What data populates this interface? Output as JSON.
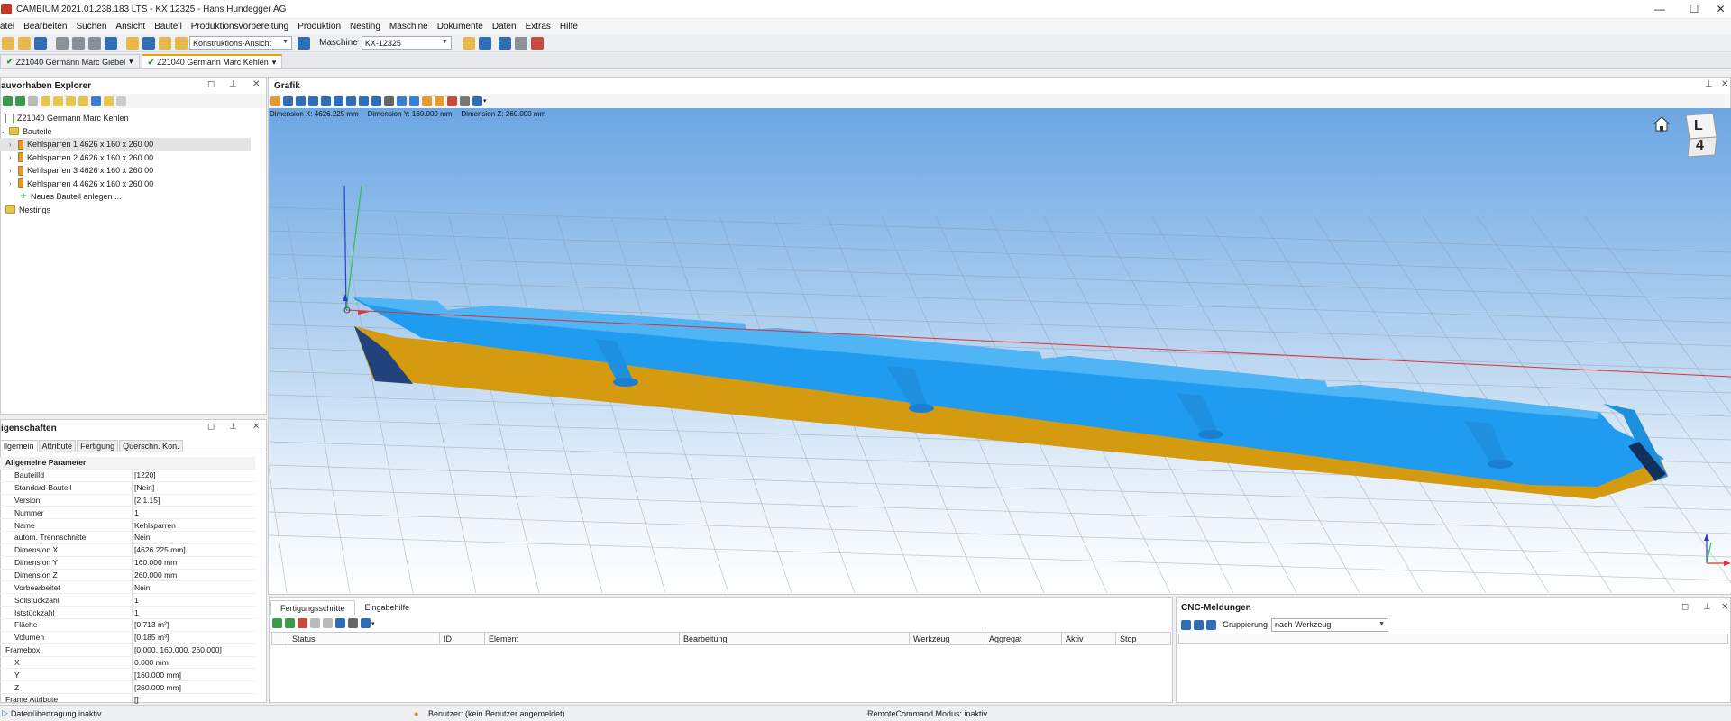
{
  "window": {
    "title": "CAMBIUM 2021.01.238.183 LTS - KX 12325 - Hans Hundegger AG",
    "min_icon": "minimize-icon",
    "max_icon": "maximize-icon",
    "close_icon": "close-icon"
  },
  "menu": [
    "atei",
    "Bearbeiten",
    "Suchen",
    "Ansicht",
    "Bauteil",
    "Produktionsvorbereitung",
    "Produktion",
    "Nesting",
    "Maschine",
    "Dokumente",
    "Daten",
    "Extras",
    "Hilfe"
  ],
  "toolbar": {
    "view_combo": "Konstruktions-Ansicht",
    "machine_label": "Maschine",
    "machine_combo": "KX-12325"
  },
  "doc_tabs": [
    "Z21040 Germann Marc Giebel",
    "Z21040 Germann Marc Kehlen"
  ],
  "explorer": {
    "title": "auvorhaben Explorer",
    "tree": [
      {
        "label": "Z21040 Germann Marc Kehlen",
        "icon": "doc"
      },
      {
        "label": "Bauteile",
        "icon": "folder"
      },
      {
        "label": "Kehlsparren 1 4626 x 160 x 260 00",
        "icon": "beam"
      },
      {
        "label": "Kehlsparren 2 4626 x 160 x 260 00",
        "icon": "beam"
      },
      {
        "label": "Kehlsparren 3 4626 x 160 x 260 00",
        "icon": "beam"
      },
      {
        "label": "Kehlsparren 4 4626 x 160 x 260 00",
        "icon": "beam"
      },
      {
        "label": "Neues Bauteil anlegen ...",
        "icon": "plus"
      },
      {
        "label": "Nestings",
        "icon": "folder"
      }
    ]
  },
  "properties": {
    "title": "igenschaften",
    "tabs": [
      "llgemein",
      "Attribute",
      "Fertigung",
      "Querschn. Kon."
    ],
    "group": "Allgemeine Parameter",
    "rows": [
      {
        "k": "BauteilId",
        "v": "[1220]"
      },
      {
        "k": "Standard-Bauteil",
        "v": "[Nein]"
      },
      {
        "k": "Version",
        "v": "[2.1.15]"
      },
      {
        "k": "Nummer",
        "v": "1"
      },
      {
        "k": "Name",
        "v": "Kehlsparren"
      },
      {
        "k": "autom. Trennschnitte",
        "v": "Nein"
      },
      {
        "k": "Dimension X",
        "v": "[4626.225 mm]"
      },
      {
        "k": "Dimension Y",
        "v": "160.000 mm"
      },
      {
        "k": "Dimension Z",
        "v": "260.000 mm"
      },
      {
        "k": "Vorbearbeitet",
        "v": "Nein"
      },
      {
        "k": "Sollstückzahl",
        "v": "1"
      },
      {
        "k": "Iststückzahl",
        "v": "1"
      },
      {
        "k": "Fläche",
        "v": "[0.713 m²]"
      },
      {
        "k": "Volumen",
        "v": "[0.185 m³]"
      },
      {
        "k": "Framebox",
        "v": "[0.000, 160.000, 260.000]",
        "sub": true
      },
      {
        "k": "X",
        "v": "0.000 mm"
      },
      {
        "k": "Y",
        "v": "[160.000 mm]"
      },
      {
        "k": "Z",
        "v": "[260.000 mm]"
      },
      {
        "k": "Frame Attribute",
        "v": "[]",
        "sub": true
      }
    ]
  },
  "graphics": {
    "title": "Grafik",
    "dim_x": "Dimension X: 4626.225 mm",
    "dim_y": "Dimension Y: 160.000 mm",
    "dim_z": "Dimension Z: 260.000 mm",
    "viewcube_top": "L",
    "viewcube_front": "4"
  },
  "bottom": {
    "tabs": [
      "Fertigungsschritte",
      "Eingabehilfe"
    ],
    "columns": [
      "",
      "Status",
      "ID",
      "Element",
      "Bearbeitung",
      "Werkzeug",
      "Aggregat",
      "Aktiv",
      "Stop"
    ]
  },
  "cnc": {
    "title": "CNC-Meldungen",
    "group_label": "Gruppierung",
    "group_value": "nach Werkzeug"
  },
  "status": {
    "transfer": "Datenübertragung inaktiv",
    "user": "Benutzer: (kein Benutzer angemeldet)",
    "remote": "RemoteCommand Modus: inaktiv"
  },
  "colors": {
    "beam_top": "#1e9df0",
    "beam_side": "#d59a0e",
    "sky_top": "#6ca6e3"
  }
}
